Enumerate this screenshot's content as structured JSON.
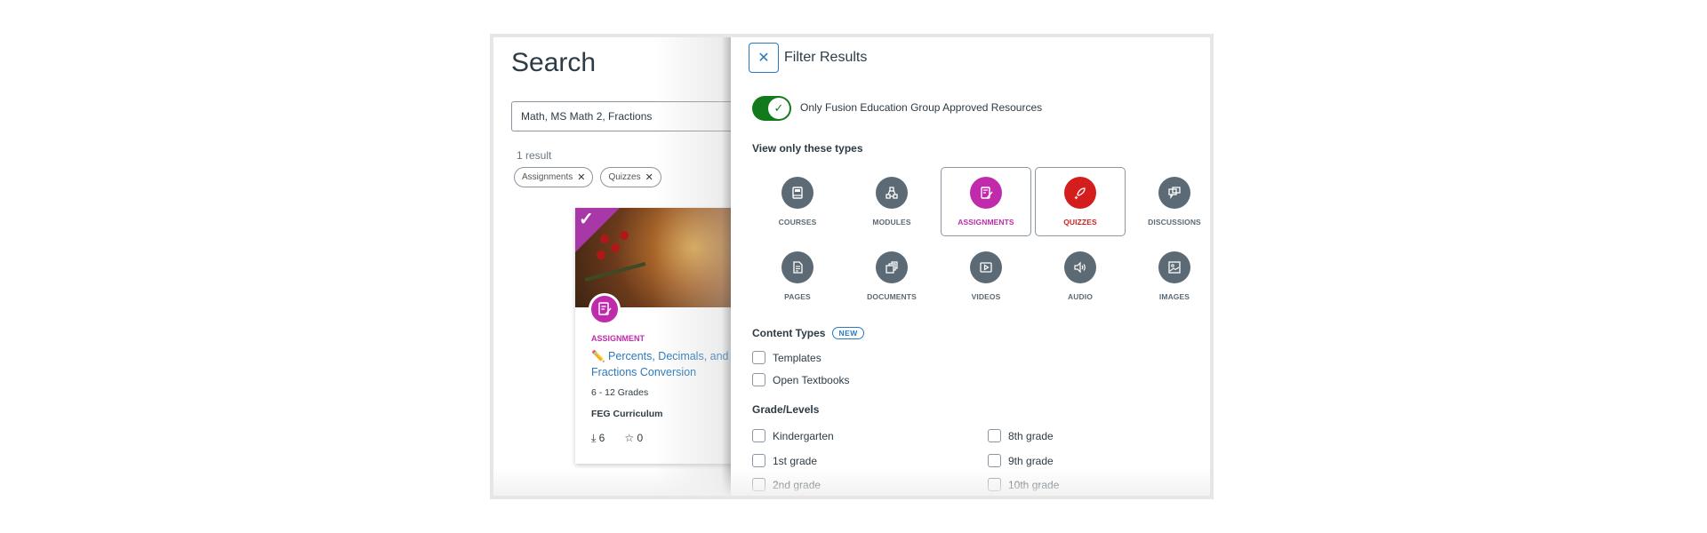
{
  "search": {
    "title": "Search",
    "query": "Math, MS Math 2, Fractions",
    "result_count": "1 result",
    "chips": [
      {
        "label": "Assignments",
        "remove": "✕"
      },
      {
        "label": "Quizzes",
        "remove": "✕"
      }
    ]
  },
  "card": {
    "type": "ASSIGNMENT",
    "title": "✏️ Percents, Decimals, and Fractions Conversion",
    "grades": "6 - 12 Grades",
    "org": "FEG Curriculum",
    "downloads": "6",
    "favorites": "0",
    "type_color": "#c02bac"
  },
  "filter": {
    "title": "Filter Results",
    "close": "✕",
    "toggle_label": "Only Fusion Education Group Approved Resources",
    "toggle_on": true,
    "types_heading": "View only these types",
    "types": [
      {
        "label": "COURSES",
        "icon": "course-icon",
        "selected": false
      },
      {
        "label": "MODULES",
        "icon": "modules-icon",
        "selected": false
      },
      {
        "label": "ASSIGNMENTS",
        "icon": "assignment-icon",
        "selected": true,
        "color": "#c02bac"
      },
      {
        "label": "QUIZZES",
        "icon": "quiz-rocket-icon",
        "selected": true,
        "color": "#d41e1e"
      },
      {
        "label": "DISCUSSIONS",
        "icon": "discussions-icon",
        "selected": false
      },
      {
        "label": "PAGES",
        "icon": "page-icon",
        "selected": false
      },
      {
        "label": "DOCUMENTS",
        "icon": "documents-icon",
        "selected": false
      },
      {
        "label": "VIDEOS",
        "icon": "video-icon",
        "selected": false
      },
      {
        "label": "AUDIO",
        "icon": "audio-icon",
        "selected": false
      },
      {
        "label": "IMAGES",
        "icon": "image-icon",
        "selected": false
      }
    ],
    "content_types_heading": "Content Types",
    "new_badge": "NEW",
    "content_types": [
      "Templates",
      "Open Textbooks"
    ],
    "grade_heading": "Grade/Levels",
    "grades_left": [
      "Kindergarten",
      "1st grade",
      "2nd grade"
    ],
    "grades_right": [
      "8th grade",
      "9th grade",
      "10th grade"
    ]
  }
}
